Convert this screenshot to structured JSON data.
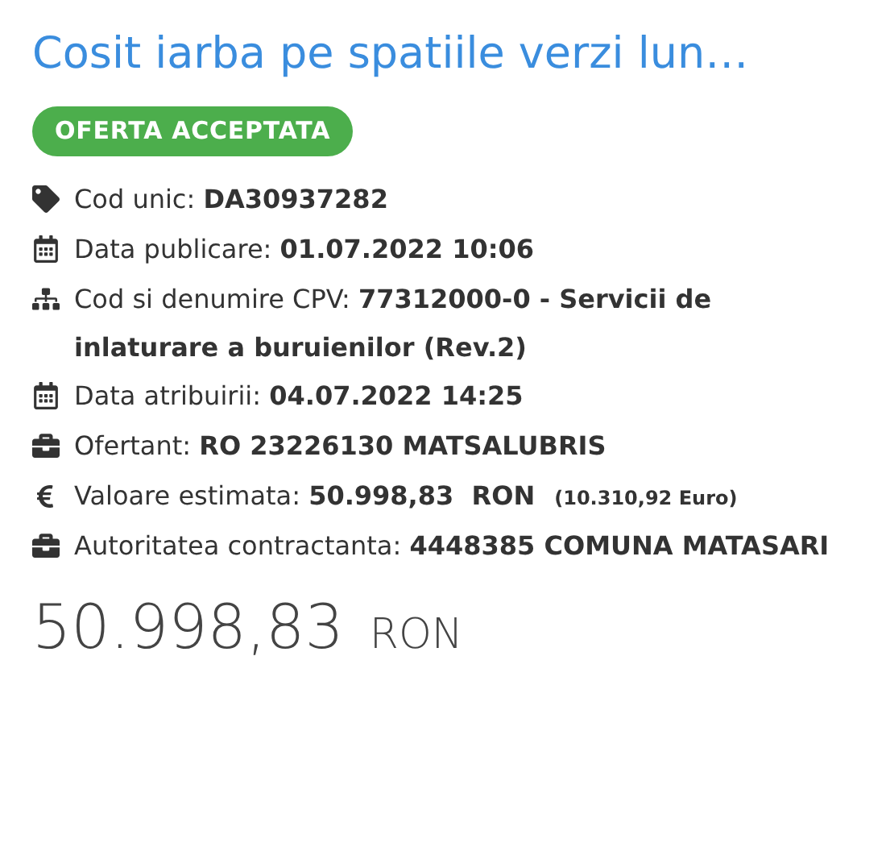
{
  "title": "Cosit iarba pe spatiile verzi lun…",
  "status": {
    "label": "OFERTA ACCEPTATA",
    "color": "#4cae4c"
  },
  "fields": [
    {
      "kind": "tag",
      "label": "Cod unic:",
      "value": "DA30937282"
    },
    {
      "kind": "calendar",
      "label": "Data publicare:",
      "value": "01.07.2022 10:06"
    },
    {
      "kind": "sitemap",
      "label": "Cod si denumire CPV:",
      "value": "77312000-0 - Servicii de inlaturare a buruienilor (Rev.2)"
    },
    {
      "kind": "calendar",
      "label": "Data atribuirii:",
      "value": "04.07.2022 14:25"
    },
    {
      "kind": "briefcase",
      "label": "Ofertant:",
      "value": "RO 23226130 MATSALUBRIS"
    },
    {
      "kind": "euro",
      "label": "Valoare estimata:",
      "value": "50.998,83  RON",
      "note": "(10.310,92 Euro)"
    },
    {
      "kind": "briefcase",
      "label": "Autoritatea contractanta:",
      "value": "4448385 COMUNA MATASARI"
    }
  ],
  "price": {
    "amount": "50.998,83",
    "currency": "RON"
  }
}
